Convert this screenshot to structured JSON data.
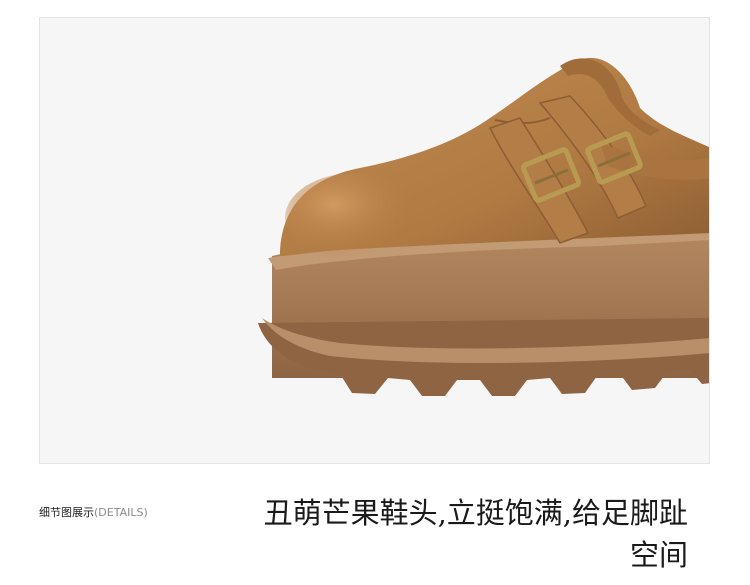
{
  "photo": {
    "alt_icon": "suede-clog-image",
    "colors": {
      "background": "#f6f6f6",
      "suede": "#b7834c",
      "suede_shadow": "#8d5e31",
      "sole": "#a87c55",
      "sole_dark": "#7d5638",
      "buckle": "#b99a52"
    }
  },
  "section": {
    "label": "细节图展示",
    "sublabel": "(DETAILS)"
  },
  "caption": {
    "line1": "丑萌芒果鞋头,立挺饱满,给足脚趾",
    "line2": "空间"
  }
}
